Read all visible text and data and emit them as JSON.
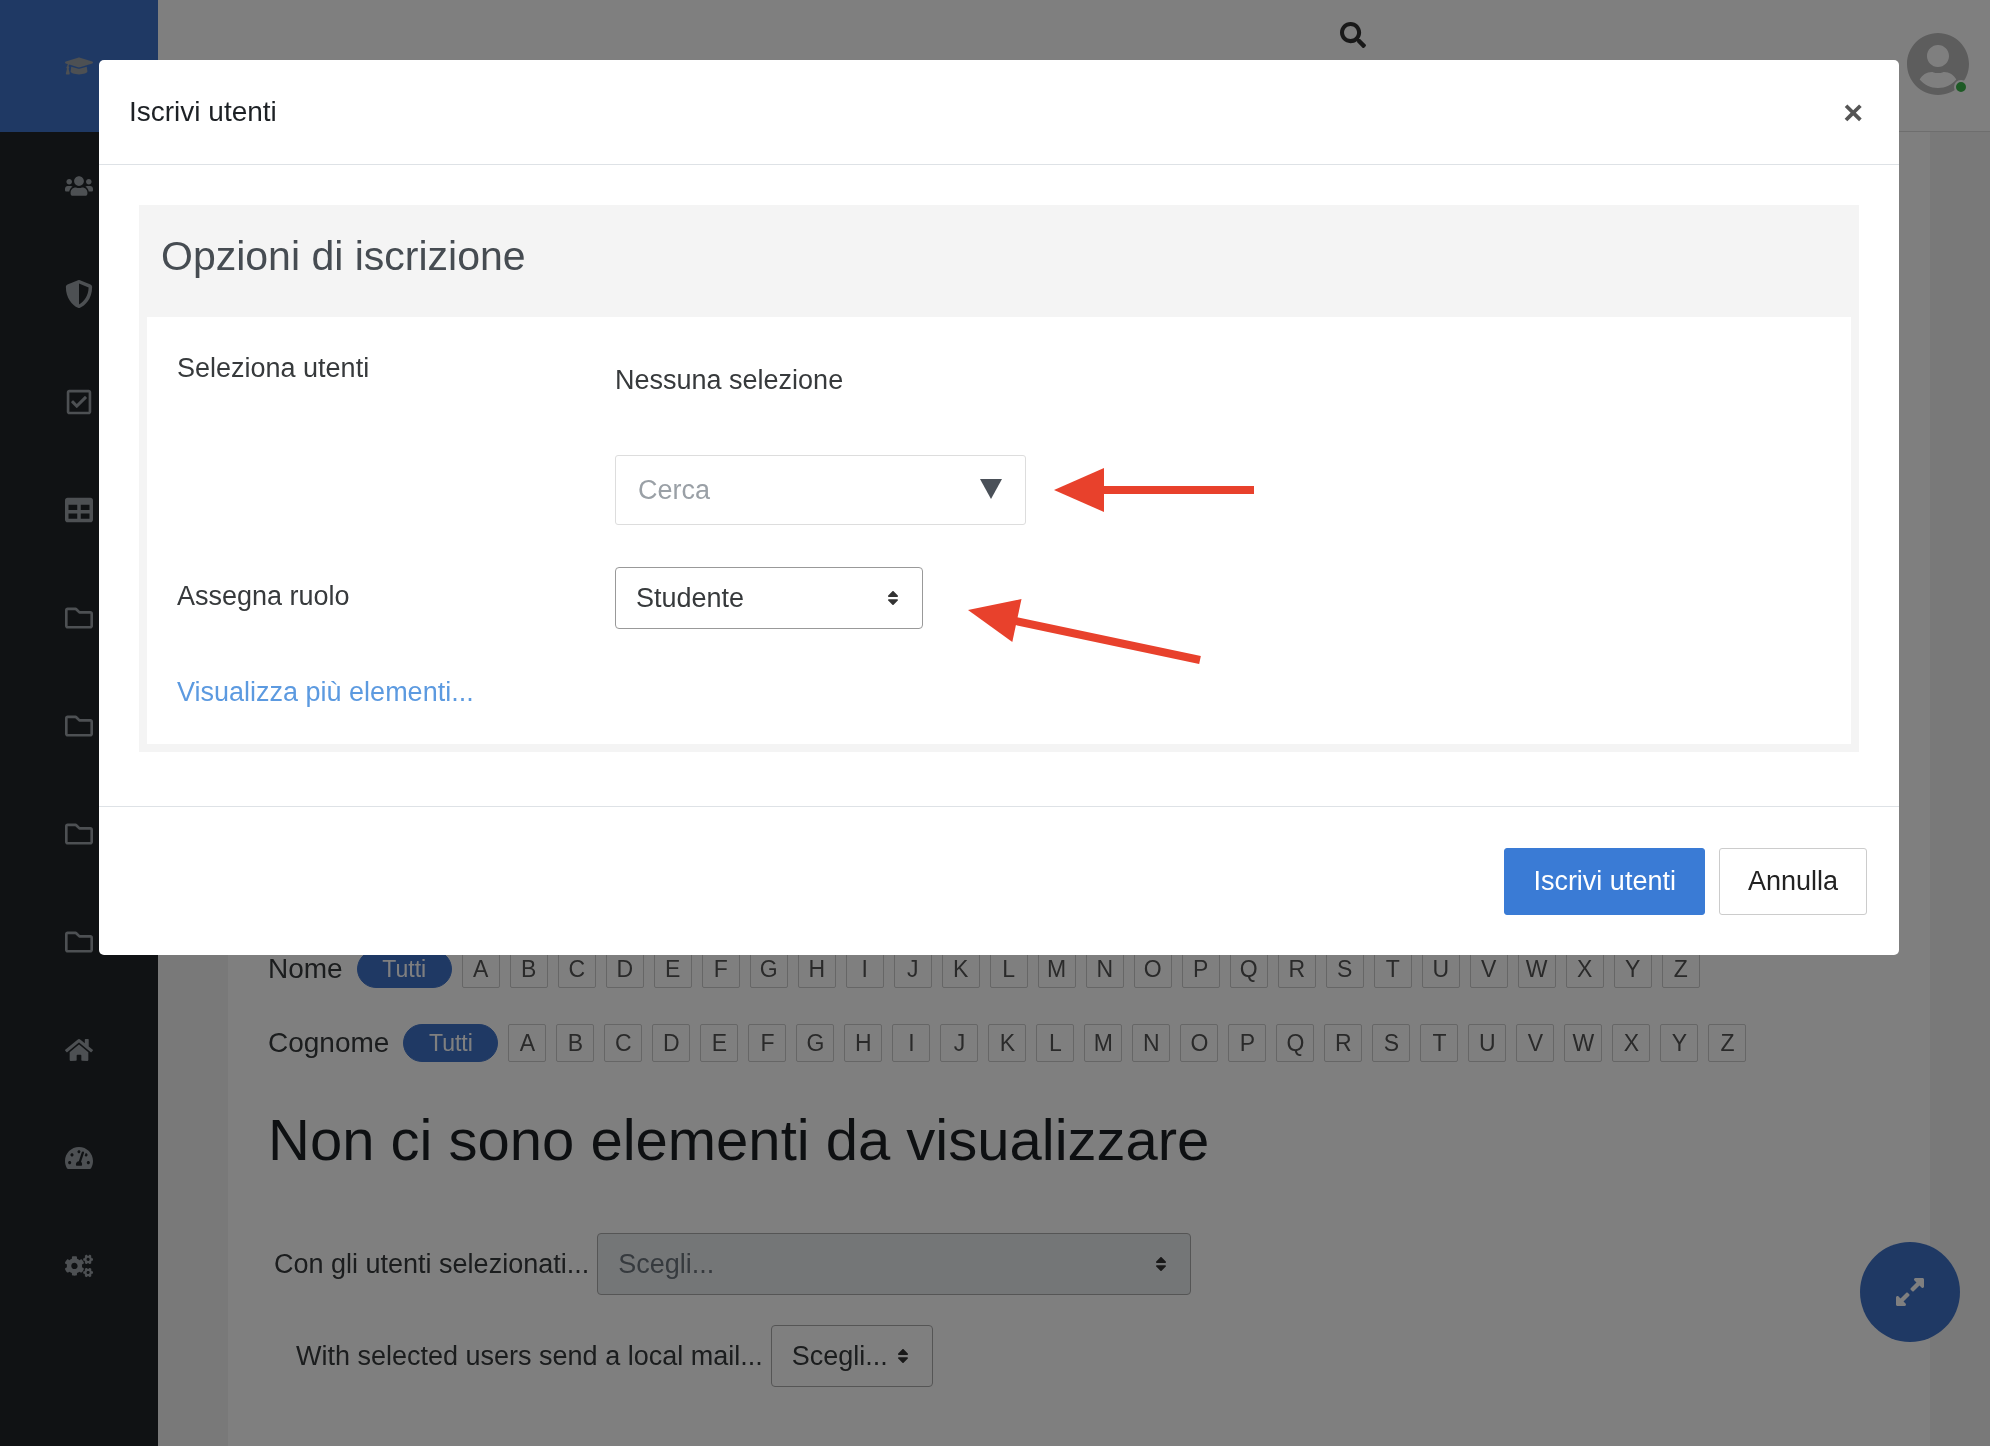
{
  "sidebar": {
    "items": [
      {
        "kind": "course",
        "selected": true
      },
      {
        "kind": "participants",
        "selected": false
      },
      {
        "kind": "badges",
        "selected": false
      },
      {
        "kind": "competencies",
        "selected": false
      },
      {
        "kind": "grades",
        "selected": false
      },
      {
        "kind": "folder",
        "selected": false
      },
      {
        "kind": "folder",
        "selected": false
      },
      {
        "kind": "folder",
        "selected": false
      },
      {
        "kind": "folder",
        "selected": false
      },
      {
        "kind": "home",
        "selected": false
      },
      {
        "kind": "dashboard",
        "selected": false
      },
      {
        "kind": "admin",
        "selected": false
      }
    ]
  },
  "page": {
    "filters": [
      {
        "label": "Nome",
        "options": [
          {
            "label": "Tutti",
            "selected": true
          },
          {
            "label": "A",
            "selected": false
          },
          {
            "label": "B",
            "selected": false
          },
          {
            "label": "C",
            "selected": false
          },
          {
            "label": "D",
            "selected": false
          },
          {
            "label": "E",
            "selected": false
          },
          {
            "label": "F",
            "selected": false
          },
          {
            "label": "G",
            "selected": false
          },
          {
            "label": "H",
            "selected": false
          },
          {
            "label": "I",
            "selected": false
          },
          {
            "label": "J",
            "selected": false
          },
          {
            "label": "K",
            "selected": false
          },
          {
            "label": "L",
            "selected": false
          },
          {
            "label": "M",
            "selected": false
          },
          {
            "label": "N",
            "selected": false
          },
          {
            "label": "O",
            "selected": false
          },
          {
            "label": "P",
            "selected": false
          },
          {
            "label": "Q",
            "selected": false
          },
          {
            "label": "R",
            "selected": false
          },
          {
            "label": "S",
            "selected": false
          },
          {
            "label": "T",
            "selected": false
          },
          {
            "label": "U",
            "selected": false
          },
          {
            "label": "V",
            "selected": false
          },
          {
            "label": "W",
            "selected": false
          },
          {
            "label": "X",
            "selected": false
          },
          {
            "label": "Y",
            "selected": false
          },
          {
            "label": "Z",
            "selected": false
          }
        ]
      },
      {
        "label": "Cognome",
        "options": [
          {
            "label": "Tutti",
            "selected": true
          },
          {
            "label": "A",
            "selected": false
          },
          {
            "label": "B",
            "selected": false
          },
          {
            "label": "C",
            "selected": false
          },
          {
            "label": "D",
            "selected": false
          },
          {
            "label": "E",
            "selected": false
          },
          {
            "label": "F",
            "selected": false
          },
          {
            "label": "G",
            "selected": false
          },
          {
            "label": "H",
            "selected": false
          },
          {
            "label": "I",
            "selected": false
          },
          {
            "label": "J",
            "selected": false
          },
          {
            "label": "K",
            "selected": false
          },
          {
            "label": "L",
            "selected": false
          },
          {
            "label": "M",
            "selected": false
          },
          {
            "label": "N",
            "selected": false
          },
          {
            "label": "O",
            "selected": false
          },
          {
            "label": "P",
            "selected": false
          },
          {
            "label": "Q",
            "selected": false
          },
          {
            "label": "R",
            "selected": false
          },
          {
            "label": "S",
            "selected": false
          },
          {
            "label": "T",
            "selected": false
          },
          {
            "label": "U",
            "selected": false
          },
          {
            "label": "V",
            "selected": false
          },
          {
            "label": "W",
            "selected": false
          },
          {
            "label": "X",
            "selected": false
          },
          {
            "label": "Y",
            "selected": false
          },
          {
            "label": "Z",
            "selected": false
          }
        ]
      }
    ],
    "empty_message": "Non ci sono elementi da visualizzare",
    "bulk_actions": [
      {
        "label": "Con gli utenti selezionati...",
        "placeholder": "Scegli..."
      },
      {
        "label": "With selected users send a local mail...",
        "placeholder": "Scegli..."
      }
    ]
  },
  "modal": {
    "title": "Iscrivi utenti",
    "close": "×",
    "section_title": "Opzioni di iscrizione",
    "select_users": {
      "label": "Seleziona utenti",
      "selection": "Nessuna selezione",
      "placeholder": "Cerca"
    },
    "role": {
      "label": "Assegna ruolo",
      "value": "Studente"
    },
    "more_link": "Visualizza più elementi...",
    "buttons": [
      {
        "label": "Iscrivi utenti",
        "kind": "primary"
      },
      {
        "label": "Annulla",
        "kind": "secondary"
      }
    ]
  }
}
